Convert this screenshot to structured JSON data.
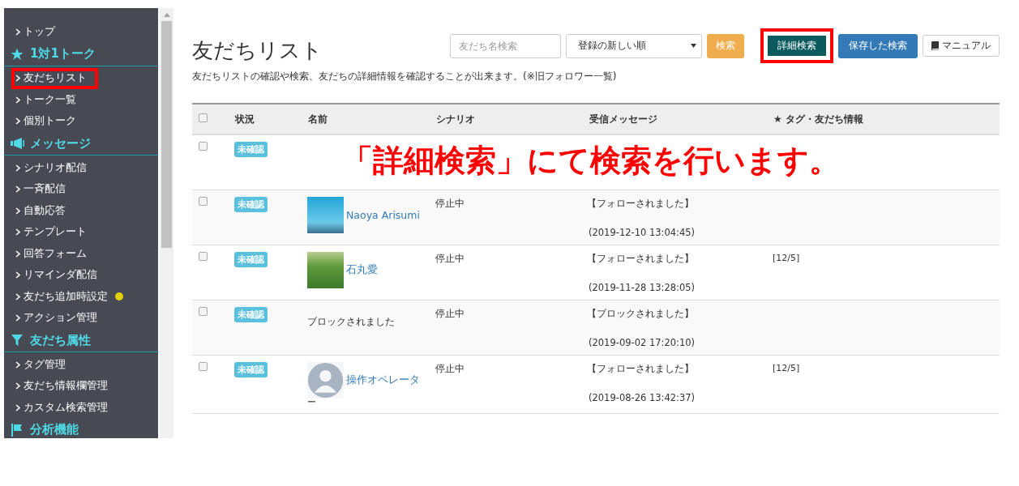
{
  "sidebar": {
    "items": [
      {
        "kind": "link",
        "label": "トップ",
        "annotated": false,
        "dot": false
      },
      {
        "kind": "header",
        "label": "1対1トーク"
      },
      {
        "kind": "link",
        "label": "友だちリスト",
        "annotated": true,
        "dot": false
      },
      {
        "kind": "link",
        "label": "トーク一覧",
        "annotated": false,
        "dot": false
      },
      {
        "kind": "link",
        "label": "個別トーク",
        "annotated": false,
        "dot": false
      },
      {
        "kind": "header",
        "label": "メッセージ"
      },
      {
        "kind": "link",
        "label": "シナリオ配信",
        "annotated": false,
        "dot": false
      },
      {
        "kind": "link",
        "label": "一斉配信",
        "annotated": false,
        "dot": false
      },
      {
        "kind": "link",
        "label": "自動応答",
        "annotated": false,
        "dot": false
      },
      {
        "kind": "link",
        "label": "テンプレート",
        "annotated": false,
        "dot": false
      },
      {
        "kind": "link",
        "label": "回答フォーム",
        "annotated": false,
        "dot": false
      },
      {
        "kind": "link",
        "label": "リマインダ配信",
        "annotated": false,
        "dot": false
      },
      {
        "kind": "link",
        "label": "友だち追加時設定",
        "annotated": false,
        "dot": true
      },
      {
        "kind": "link",
        "label": "アクション管理",
        "annotated": false,
        "dot": false
      },
      {
        "kind": "header",
        "label": "友だち属性"
      },
      {
        "kind": "link",
        "label": "タグ管理",
        "annotated": false,
        "dot": false
      },
      {
        "kind": "link",
        "label": "友だち情報欄管理",
        "annotated": false,
        "dot": false
      },
      {
        "kind": "link",
        "label": "カスタム検索管理",
        "annotated": false,
        "dot": false
      },
      {
        "kind": "header",
        "label": "分析機能"
      }
    ]
  },
  "page": {
    "title": "友だちリスト",
    "description": "友だちリストの確認や検索、友だちの詳細情報を確認することが出来ます。(※旧フォロワー一覧)"
  },
  "toolbar": {
    "search": {
      "placeholder": "友だち名検索"
    },
    "sort": {
      "value": "登録の新しい順"
    },
    "buttons": [
      {
        "kind": "search",
        "label": "検索",
        "annotated": false
      },
      {
        "kind": "detail",
        "label": "詳細検索",
        "annotated": true
      },
      {
        "kind": "saved",
        "label": "保存した検索",
        "annotated": false
      },
      {
        "kind": "manual",
        "label": "マニュアル",
        "annotated": false
      }
    ]
  },
  "table": {
    "columns": [
      "状況",
      "名前",
      "シナリオ",
      "受信メッセージ",
      "★ タグ・友だち情報"
    ],
    "select_all_checked": false,
    "rows": [
      {
        "kind": "plain",
        "checked": false,
        "status": "未確認"
      },
      {
        "kind": "photo",
        "checked": false,
        "status": "未確認",
        "name": "Naoya Arisumi",
        "scenario": "停止中",
        "message": "【フォローされました】",
        "date": "(2019-12-10 13:04:45)"
      },
      {
        "kind": "photo",
        "checked": false,
        "status": "未確認",
        "name": "石丸愛",
        "scenario": "停止中",
        "message": "【フォローされました】",
        "date": "(2019-11-28 13:28:05)",
        "tags": "[12/5]"
      },
      {
        "kind": "blocked",
        "checked": false,
        "status": "未確認",
        "blocked_note": "ブロックされました",
        "scenario": "停止中",
        "message": "【ブロックされました】",
        "date": "(2019-09-02 17:20:10)"
      },
      {
        "kind": "silhouette",
        "checked": false,
        "status": "未確認",
        "name": "操作オペレータ",
        "name_extra": "ー",
        "scenario": "停止中",
        "message": "【フォローされました】",
        "date": "(2019-08-26 13:42:37)",
        "tags": "[12/5]"
      }
    ]
  },
  "annotation": {
    "text": "「詳細検索」にて検索を行います。"
  }
}
